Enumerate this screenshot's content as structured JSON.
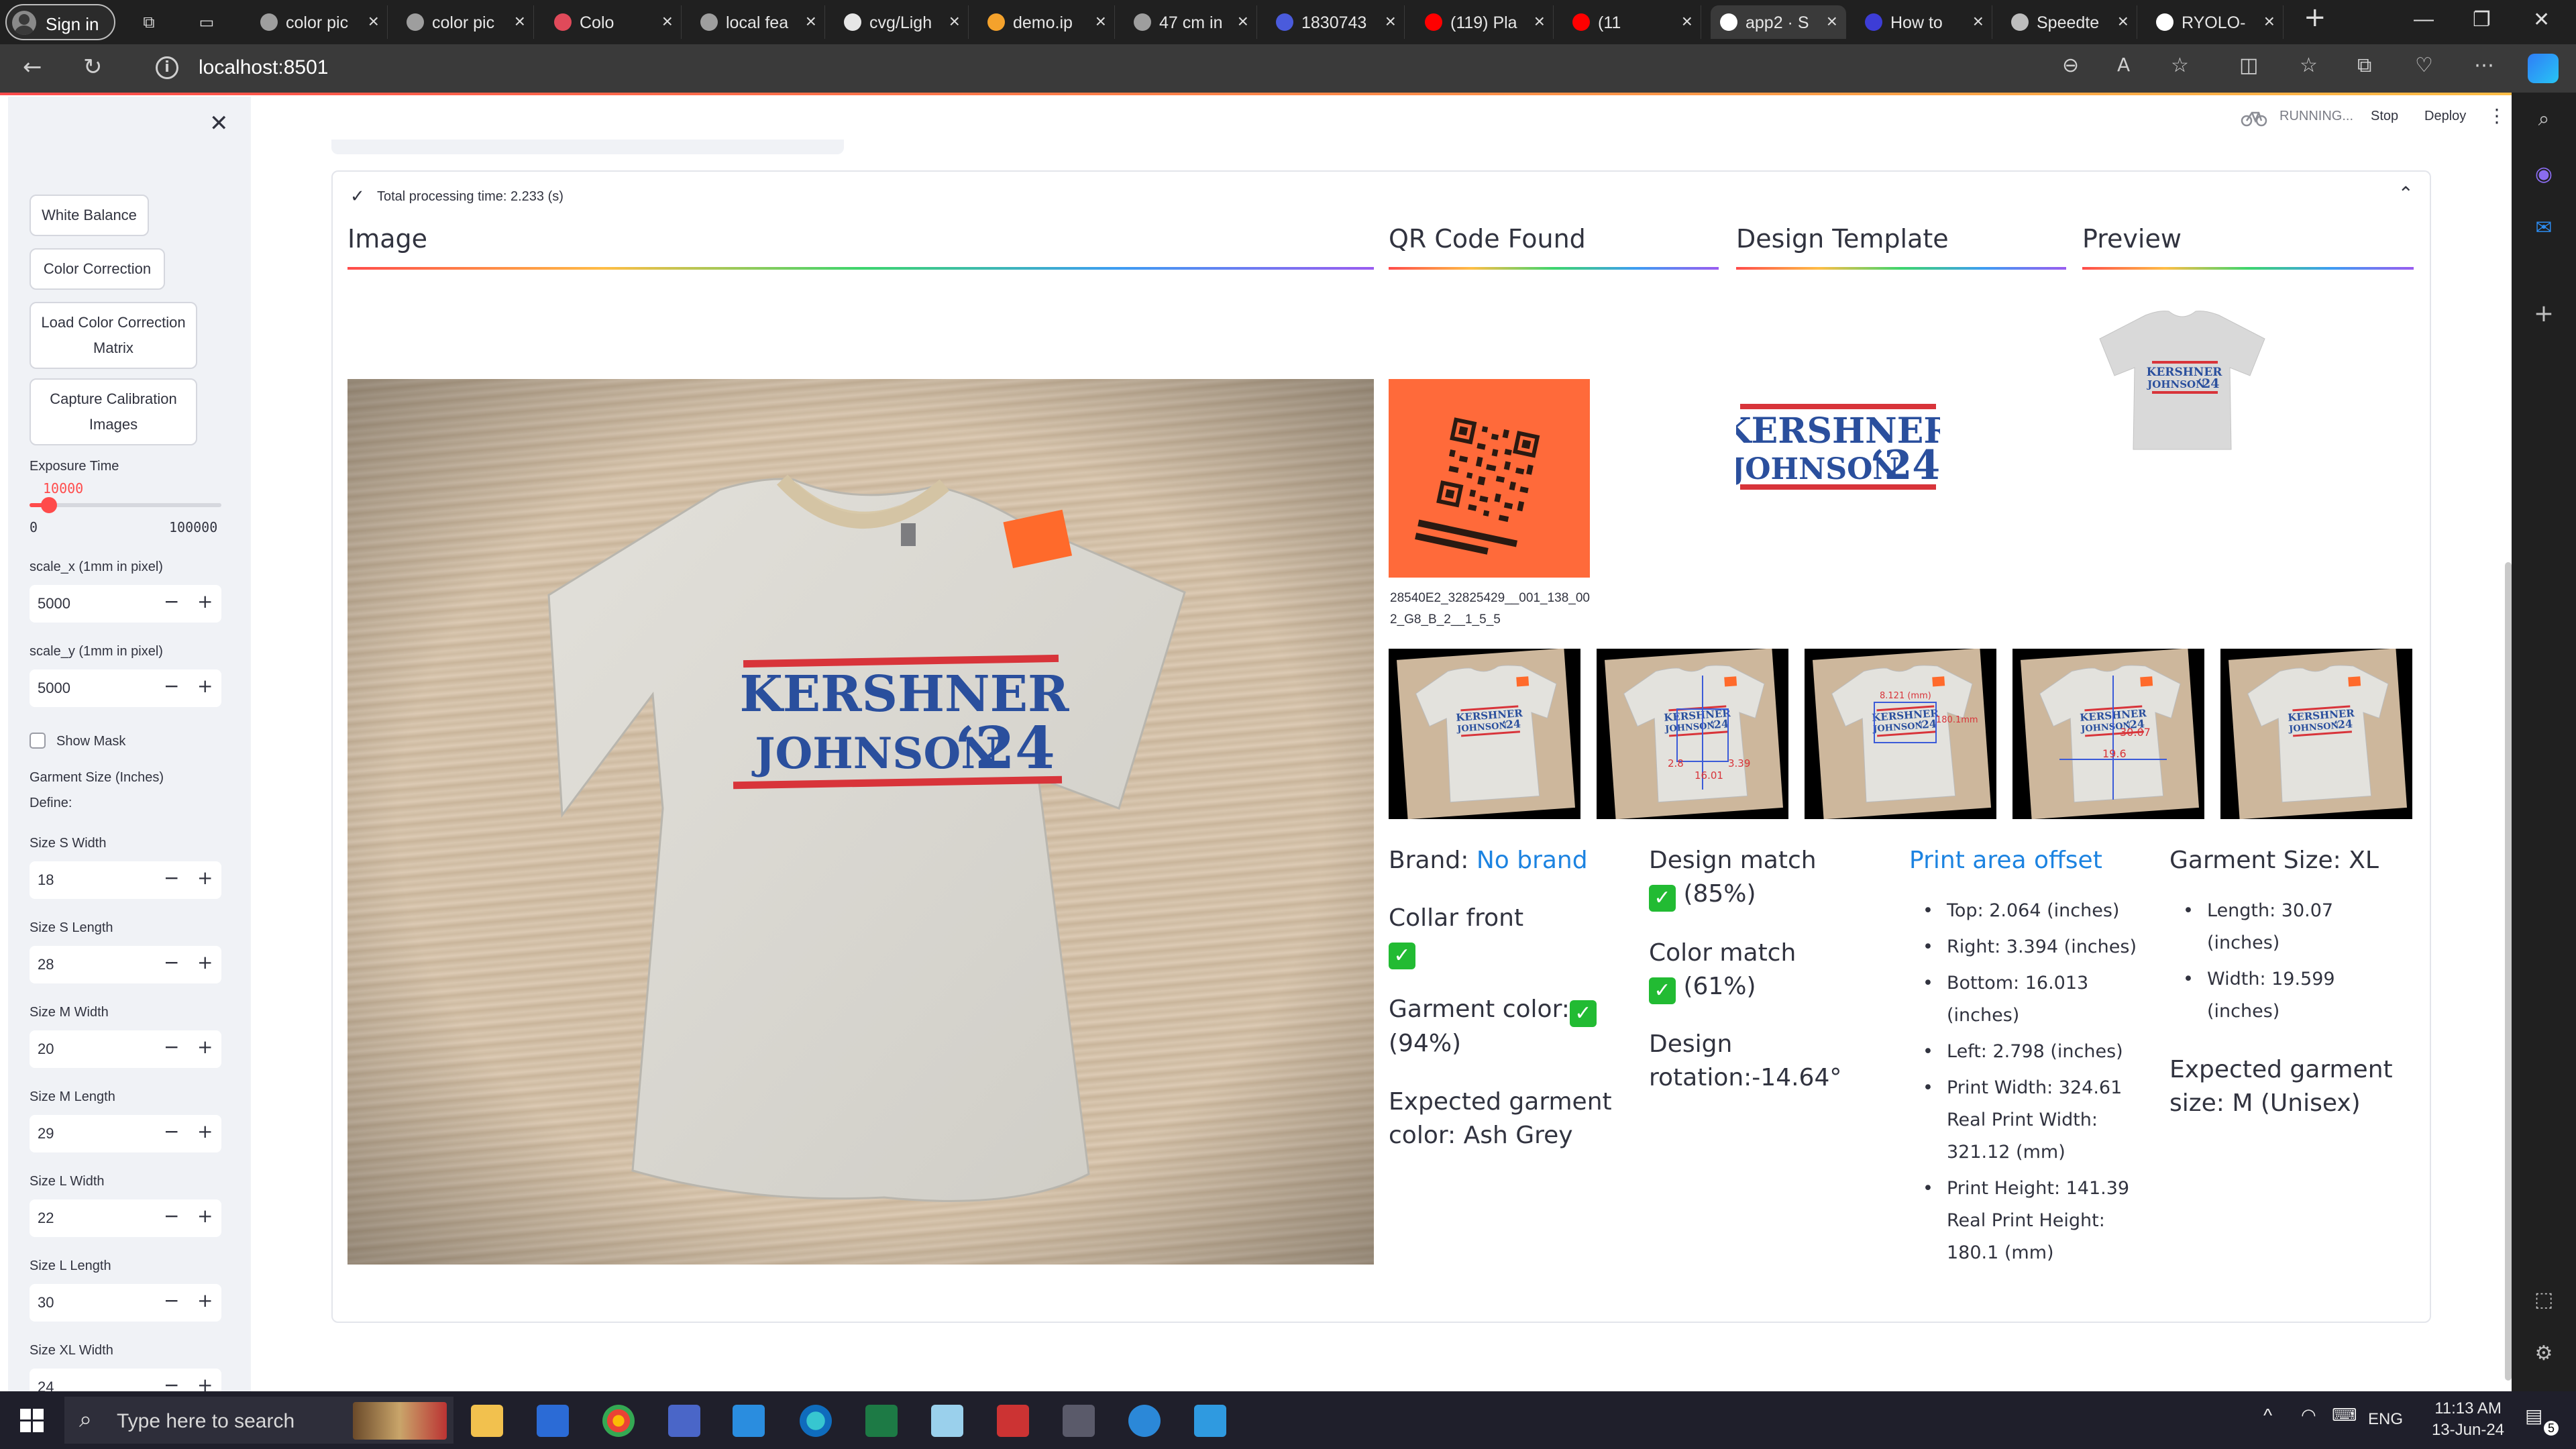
{
  "browser": {
    "signin": "Sign in",
    "tabs": [
      {
        "title": "color pic",
        "color": "#9e9e9e"
      },
      {
        "title": "color pic",
        "color": "#9e9e9e"
      },
      {
        "title": "Colo",
        "color": "#e04a5a"
      },
      {
        "title": "local fea",
        "color": "#9e9e9e"
      },
      {
        "title": "cvg/Ligh",
        "color": "#e6e6e6"
      },
      {
        "title": "demo.ip",
        "color": "#f4a22c"
      },
      {
        "title": "47 cm in",
        "color": "#9e9e9e"
      },
      {
        "title": "1830743",
        "color": "#4a5bdc"
      },
      {
        "title": "(119) Pla",
        "color": "#ff0000"
      },
      {
        "title": "(11",
        "color": "#ff0000"
      },
      {
        "title": "app2 · S",
        "color": "#ffffff"
      },
      {
        "title": "How to",
        "color": "#3d3dd6"
      },
      {
        "title": "Speedte",
        "color": "#bdbdbd"
      },
      {
        "title": "RYOLO-",
        "color": "#ffffff"
      }
    ],
    "url": "localhost:8501"
  },
  "toolbar": {
    "status": "RUNNING...",
    "stop": "Stop",
    "deploy": "Deploy"
  },
  "sidebar": {
    "buttons": {
      "white_balance": "White Balance",
      "color_correction": "Color Correction",
      "load_matrix": "Load Color Correction Matrix",
      "capture_calibration": "Capture Calibration Images"
    },
    "exposure": {
      "label": "Exposure Time",
      "value": "10000",
      "min": "0",
      "max": "100000",
      "fraction": 0.1
    },
    "scale_x": {
      "label": "scale_x (1mm in pixel)",
      "value": "5000"
    },
    "scale_y": {
      "label": "scale_y (1mm in pixel)",
      "value": "5000"
    },
    "show_mask": "Show Mask",
    "garment_heading": "Garment Size (Inches)",
    "define": "Define:",
    "sizes": [
      {
        "label": "Size S Width",
        "value": "18"
      },
      {
        "label": "Size S Length",
        "value": "28"
      },
      {
        "label": "Size M Width",
        "value": "20"
      },
      {
        "label": "Size M Length",
        "value": "29"
      },
      {
        "label": "Size L Width",
        "value": "22"
      },
      {
        "label": "Size L Length",
        "value": "30"
      },
      {
        "label": "Size XL Width",
        "value": "24"
      }
    ]
  },
  "expander": {
    "title": "Total processing time: 2.233 (s)"
  },
  "columns": {
    "image": "Image",
    "qr": "QR Code Found",
    "template": "Design Template",
    "preview": "Preview"
  },
  "qr_caption": "28540E2_32825429__001_138_002_G8_B_2__1_5_5",
  "design": {
    "line1": "KERSHNER",
    "line2": "JOHNSON",
    "year": "‘24",
    "red": "#d8343a",
    "blue": "#2a4f9d"
  },
  "results": {
    "brand_label": "Brand:",
    "brand_value": "No brand",
    "collar": "Collar front",
    "garment_color_label": "Garment color:",
    "garment_color_pct": "(94%)",
    "expected_color": "Expected garment color: Ash Grey",
    "design_match_label": "Design match",
    "design_match_pct": "(85%)",
    "color_match_label": "Color match",
    "color_match_pct": "(61%)",
    "design_rotation": "Design rotation:-14.64°",
    "print_area_title": "Print area offset",
    "print_area": [
      "Top: 2.064 (inches)",
      "Right: 3.394 (inches)",
      "Bottom: 16.013 (inches)",
      "Left: 2.798 (inches)",
      "Print Width: 324.61 Real Print Width: 321.12 (mm)",
      "Print Height: 141.39 Real Print Height: 180.1 (mm)"
    ],
    "garment_size_title": "Garment Size: XL",
    "garment_size": [
      "Length: 30.07 (inches)",
      "Width: 19.599 (inches)"
    ],
    "expected_size": "Expected garment size: M (Unisex)"
  },
  "thumbs": {
    "t3_label": "8.121 (mm)",
    "t3_label2": "180.1mm",
    "t4_label": "30.07",
    "t4_label2": "19.6",
    "t2_labels": [
      "2.8",
      "16.01",
      "3.39"
    ]
  },
  "taskbar": {
    "search": "Type here to search",
    "lang": "ENG",
    "time": "11:13 AM",
    "date": "13-Jun-24",
    "notifications": "5"
  },
  "colors": {
    "primary": "#ff4b4b",
    "link": "#1c83e1",
    "check": "#22bb33",
    "text": "#31333f"
  }
}
